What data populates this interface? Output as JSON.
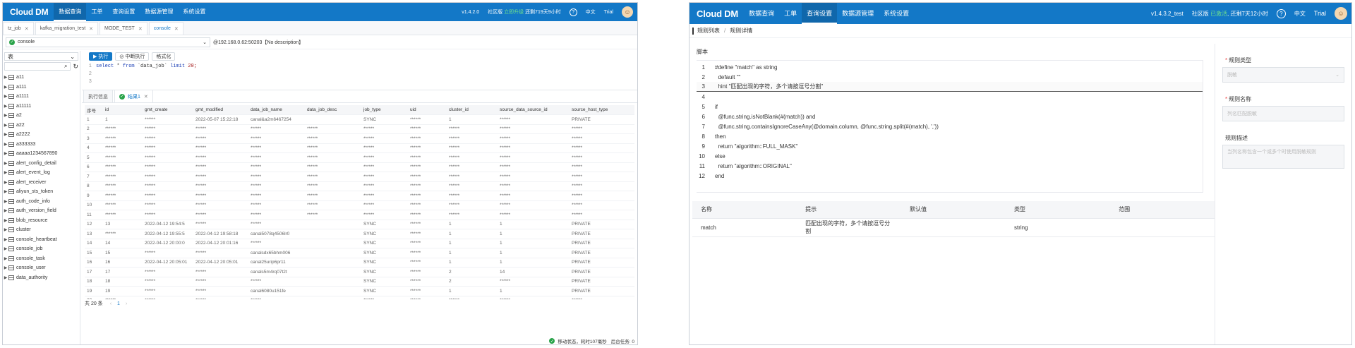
{
  "w1": {
    "logo": "Cloud DM",
    "menu": [
      "数据查询",
      "工单",
      "查询设置",
      "数据源管理",
      "系统设置"
    ],
    "version": "v1.4.2.0",
    "edition_prefix": "社区版",
    "edition_link": "立即升级",
    "remaining": "还剩719天9小时",
    "help": "?",
    "lang": "中文",
    "user": "Trial",
    "tabs": [
      "tz_job",
      "kafka_migration_test",
      "MODE_TEST",
      "console"
    ],
    "conn_select": "console",
    "conn_info": "@192.168.0.62:50203【No description】",
    "type_select": "表",
    "tables": [
      "a11",
      "a111",
      "a1111",
      "a11111",
      "a2",
      "a22",
      "a2222",
      "a333333",
      "aaaaa1234567890",
      "alert_config_detail",
      "alert_event_log",
      "alert_receiver",
      "aliyun_sts_token",
      "auth_code_info",
      "auth_version_field",
      "blob_resource",
      "cluster",
      "console_heartbeat",
      "console_job",
      "console_task",
      "console_user",
      "data_authority"
    ],
    "btn_run": "执行",
    "btn_stop": "中断执行",
    "btn_format": "格式化",
    "sql": {
      "kw1": "select",
      "rest": " * ",
      "kw2": "from",
      "tbl": " `data_job` ",
      "kw3": "limit",
      "num": " 20;"
    },
    "line_numbers": [
      "1",
      "2",
      "3"
    ],
    "result_tabs": {
      "info": "执行信息",
      "result": "结果1"
    },
    "columns": [
      "序号",
      "id",
      "gmt_create",
      "gmt_modified",
      "data_job_name",
      "data_job_desc",
      "job_type",
      "uid",
      "cluster_id",
      "source_data_source_id",
      "source_host_type"
    ],
    "rows": [
      [
        "1",
        "1",
        "******",
        "2022-05-07 15:22:18",
        "canal&a2m6467254",
        "",
        "SYNC",
        "******",
        "1",
        "******",
        "PRIVATE"
      ],
      [
        "2",
        "******",
        "******",
        "******",
        "******",
        "******",
        "******",
        "******",
        "******",
        "******",
        "******"
      ],
      [
        "3",
        "******",
        "******",
        "******",
        "******",
        "******",
        "******",
        "******",
        "******",
        "******",
        "******"
      ],
      [
        "4",
        "******",
        "******",
        "******",
        "******",
        "******",
        "******",
        "******",
        "******",
        "******",
        "******"
      ],
      [
        "5",
        "******",
        "******",
        "******",
        "******",
        "******",
        "******",
        "******",
        "******",
        "******",
        "******"
      ],
      [
        "6",
        "******",
        "******",
        "******",
        "******",
        "******",
        "******",
        "******",
        "******",
        "******",
        "******"
      ],
      [
        "7",
        "******",
        "******",
        "******",
        "******",
        "******",
        "******",
        "******",
        "******",
        "******",
        "******"
      ],
      [
        "8",
        "******",
        "******",
        "******",
        "******",
        "******",
        "******",
        "******",
        "******",
        "******",
        "******"
      ],
      [
        "9",
        "******",
        "******",
        "******",
        "******",
        "******",
        "******",
        "******",
        "******",
        "******",
        "******"
      ],
      [
        "10",
        "******",
        "******",
        "******",
        "******",
        "******",
        "******",
        "******",
        "******",
        "******",
        "******"
      ],
      [
        "11",
        "******",
        "******",
        "******",
        "******",
        "******",
        "******",
        "******",
        "******",
        "******",
        "******"
      ],
      [
        "12",
        "13",
        "2022-04-12 19:54:5",
        "******",
        "******",
        "",
        "SYNC",
        "******",
        "1",
        "1",
        "PRIVATE"
      ],
      [
        "13",
        "******",
        "2022-04-12 19:55:5",
        "2022-04-12 19:58:18",
        "canal5078q4506lr0",
        "",
        "SYNC",
        "******",
        "1",
        "1",
        "PRIVATE"
      ],
      [
        "14",
        "14",
        "2022-04-12 20:00:0",
        "2022-04-12 20:01:16",
        "******",
        "",
        "SYNC",
        "******",
        "1",
        "1",
        "PRIVATE"
      ],
      [
        "15",
        "15",
        "******",
        "******",
        "canalsdx65bhm006",
        "",
        "SYNC",
        "******",
        "1",
        "1",
        "PRIVATE"
      ],
      [
        "16",
        "16",
        "2022-04-12 20:05:01",
        "2022-04-12 20:05:01",
        "canal25urip6pr11",
        "",
        "SYNC",
        "******",
        "1",
        "1",
        "PRIVATE"
      ],
      [
        "17",
        "17",
        "******",
        "******",
        "canals5m4rq07t2t",
        "",
        "SYNC",
        "******",
        "2",
        "14",
        "PRIVATE"
      ],
      [
        "18",
        "18",
        "******",
        "******",
        "******",
        "",
        "SYNC",
        "******",
        "2",
        "******",
        "PRIVATE"
      ],
      [
        "19",
        "19",
        "******",
        "******",
        "canal6080u151fe",
        "",
        "SYNC",
        "******",
        "1",
        "1",
        "PRIVATE"
      ],
      [
        "20",
        "******",
        "******",
        "******",
        "******",
        "",
        "******",
        "******",
        "******",
        "******",
        "******"
      ]
    ],
    "total": "共 20 条",
    "page": "1",
    "status": "移动状态，耗时107毫秒",
    "bg_tasks": "后台任务: 0"
  },
  "w2": {
    "logo": "Cloud DM",
    "menu": [
      "数据查询",
      "工单",
      "查询设置",
      "数据源管理",
      "系统设置"
    ],
    "version": "v1.4.3.2_test",
    "edition_prefix": "社区版",
    "edition_link": "已激活",
    "remaining": "还剩7天12小时",
    "help": "?",
    "lang": "中文",
    "user": "Trial",
    "breadcrumb": [
      "规则列表",
      "规则详情"
    ],
    "script_label": "脚本",
    "code_lines": [
      {
        "n": "1",
        "t": "#define \"match\" as string"
      },
      {
        "n": "2",
        "t": "  default \"\""
      },
      {
        "n": "3",
        "t": "  hint \"匹配出现的字符，多个请按逗号分割\""
      },
      {
        "n": "4",
        "t": ""
      },
      {
        "n": "5",
        "t": "if"
      },
      {
        "n": "6",
        "t": "  @func.string.isNotBlank(#(match)) and"
      },
      {
        "n": "7",
        "t": "  @func.string.containsIgnoreCaseAny(@domain.column, @func.string.split(#(match), ','))"
      },
      {
        "n": "8",
        "t": "then"
      },
      {
        "n": "9",
        "t": "  return \"algorithm::FULL_MASK\""
      },
      {
        "n": "10",
        "t": "else"
      },
      {
        "n": "11",
        "t": "  return \"algorithm::ORIGINAL\""
      },
      {
        "n": "12",
        "t": "end"
      }
    ],
    "param_columns": [
      "名称",
      "提示",
      "默认值",
      "类型",
      "范围"
    ],
    "param_row": [
      "match",
      "匹配出现的字符，多个请按逗号分割",
      "",
      "string",
      ""
    ],
    "rule_type_label": "规则类型",
    "rule_type_value": "脱敏",
    "rule_name_label": "规则名称",
    "rule_name_placeholder": "列名匹配脱敏",
    "rule_desc_label": "规则描述",
    "rule_desc_placeholder": "当列名称包含一个或多个时使用脱敏规则"
  }
}
